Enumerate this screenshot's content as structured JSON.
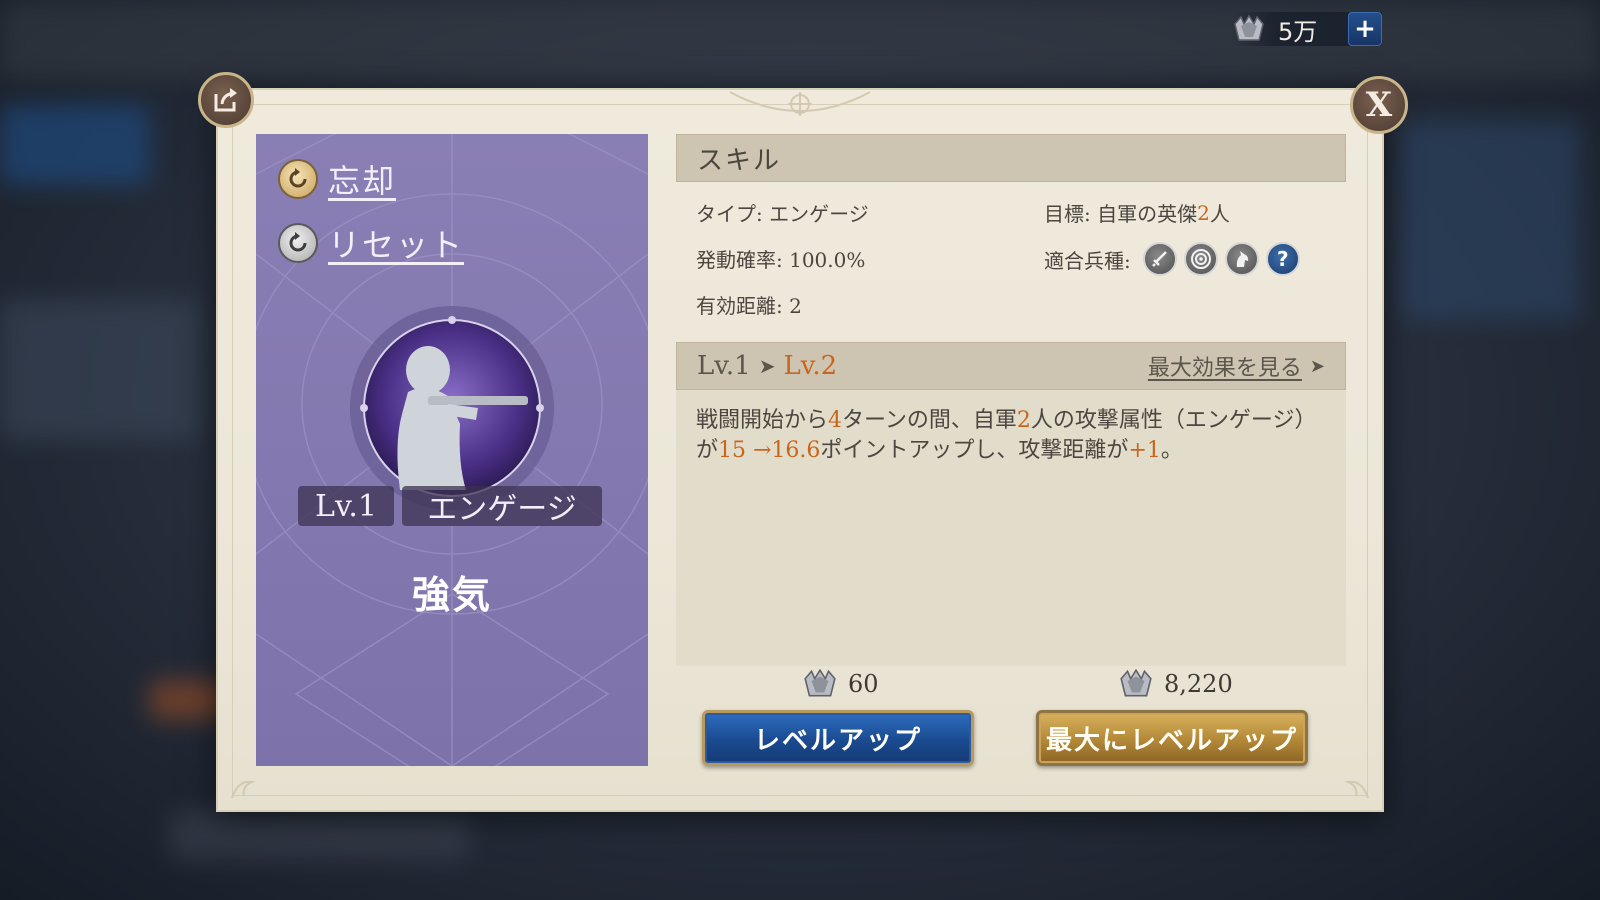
{
  "top_bar": {
    "currency_icon": "gem-icon",
    "currency_amount": "5万",
    "add_label": "+"
  },
  "dialog": {
    "share_icon": "share-icon",
    "close_label": "X",
    "left_panel": {
      "forget_label": "忘却",
      "reset_label": "リセット",
      "skill_icon": "rifleman-icon",
      "level": "Lv.1",
      "skill_type": "エンゲージ",
      "skill_name": "強気"
    },
    "skill_section": {
      "header": "スキル",
      "type": "タイプ: エンゲージ",
      "target_prefix": "目標: 自軍の英傑",
      "target_count": "2",
      "target_suffix": "人",
      "activation": "発動確率: 100.0%",
      "unit_types_label": "適合兵種:",
      "unit_type_icons": [
        "sword-icon",
        "target-icon",
        "horse-icon",
        "question-icon"
      ],
      "unit_question_mark": "?",
      "range": "有効距離: 2"
    },
    "level_section": {
      "from_level": "Lv.1",
      "arrow": "➤",
      "to_level": "Lv.2",
      "max_effect_link": "最大効果を見る",
      "max_effect_arrow": "➤"
    },
    "description": {
      "p1": "戦闘開始から",
      "turns": "4",
      "p2": "ターンの間、自軍",
      "allies": "2",
      "p3": "人の攻撃属性（エンゲージ）が",
      "values": "15 →16.6",
      "p4": "ポイントアップし、攻撃距離が",
      "range_bonus": "+1",
      "p5": "。"
    },
    "actions": {
      "levelup_cost": "60",
      "levelup_label": "レベルアップ",
      "maxlevelup_cost": "8,220",
      "maxlevelup_label": "最大にレベルアップ"
    }
  },
  "colors": {
    "panel_purple": "#8a7fb5",
    "highlight_orange": "#c9661e",
    "dialog_bg": "#efeadc",
    "button_blue": "#1a4b91",
    "button_gold": "#b28838"
  }
}
